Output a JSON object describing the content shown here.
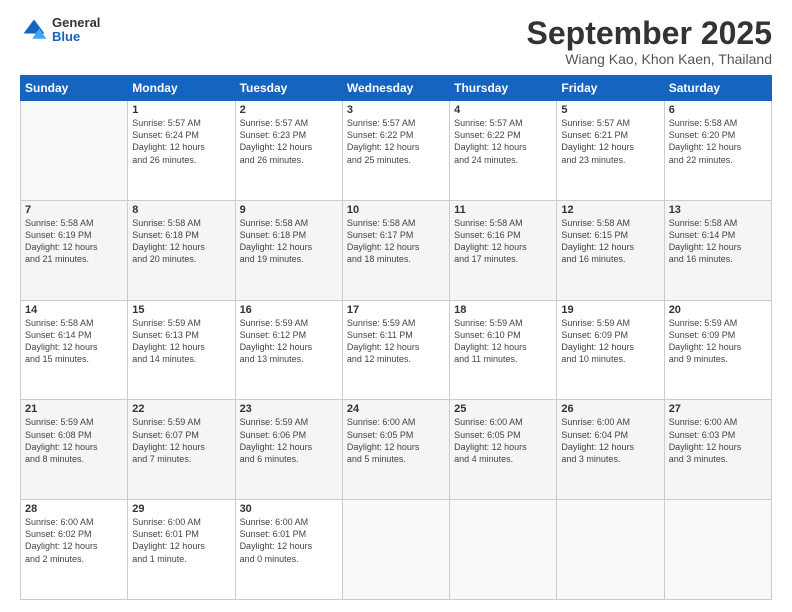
{
  "header": {
    "logo_general": "General",
    "logo_blue": "Blue",
    "month_title": "September 2025",
    "location": "Wiang Kao, Khon Kaen, Thailand"
  },
  "days_of_week": [
    "Sunday",
    "Monday",
    "Tuesday",
    "Wednesday",
    "Thursday",
    "Friday",
    "Saturday"
  ],
  "weeks": [
    [
      {
        "num": "",
        "info": ""
      },
      {
        "num": "1",
        "info": "Sunrise: 5:57 AM\nSunset: 6:24 PM\nDaylight: 12 hours\nand 26 minutes."
      },
      {
        "num": "2",
        "info": "Sunrise: 5:57 AM\nSunset: 6:23 PM\nDaylight: 12 hours\nand 26 minutes."
      },
      {
        "num": "3",
        "info": "Sunrise: 5:57 AM\nSunset: 6:22 PM\nDaylight: 12 hours\nand 25 minutes."
      },
      {
        "num": "4",
        "info": "Sunrise: 5:57 AM\nSunset: 6:22 PM\nDaylight: 12 hours\nand 24 minutes."
      },
      {
        "num": "5",
        "info": "Sunrise: 5:57 AM\nSunset: 6:21 PM\nDaylight: 12 hours\nand 23 minutes."
      },
      {
        "num": "6",
        "info": "Sunrise: 5:58 AM\nSunset: 6:20 PM\nDaylight: 12 hours\nand 22 minutes."
      }
    ],
    [
      {
        "num": "7",
        "info": "Sunrise: 5:58 AM\nSunset: 6:19 PM\nDaylight: 12 hours\nand 21 minutes."
      },
      {
        "num": "8",
        "info": "Sunrise: 5:58 AM\nSunset: 6:18 PM\nDaylight: 12 hours\nand 20 minutes."
      },
      {
        "num": "9",
        "info": "Sunrise: 5:58 AM\nSunset: 6:18 PM\nDaylight: 12 hours\nand 19 minutes."
      },
      {
        "num": "10",
        "info": "Sunrise: 5:58 AM\nSunset: 6:17 PM\nDaylight: 12 hours\nand 18 minutes."
      },
      {
        "num": "11",
        "info": "Sunrise: 5:58 AM\nSunset: 6:16 PM\nDaylight: 12 hours\nand 17 minutes."
      },
      {
        "num": "12",
        "info": "Sunrise: 5:58 AM\nSunset: 6:15 PM\nDaylight: 12 hours\nand 16 minutes."
      },
      {
        "num": "13",
        "info": "Sunrise: 5:58 AM\nSunset: 6:14 PM\nDaylight: 12 hours\nand 16 minutes."
      }
    ],
    [
      {
        "num": "14",
        "info": "Sunrise: 5:58 AM\nSunset: 6:14 PM\nDaylight: 12 hours\nand 15 minutes."
      },
      {
        "num": "15",
        "info": "Sunrise: 5:59 AM\nSunset: 6:13 PM\nDaylight: 12 hours\nand 14 minutes."
      },
      {
        "num": "16",
        "info": "Sunrise: 5:59 AM\nSunset: 6:12 PM\nDaylight: 12 hours\nand 13 minutes."
      },
      {
        "num": "17",
        "info": "Sunrise: 5:59 AM\nSunset: 6:11 PM\nDaylight: 12 hours\nand 12 minutes."
      },
      {
        "num": "18",
        "info": "Sunrise: 5:59 AM\nSunset: 6:10 PM\nDaylight: 12 hours\nand 11 minutes."
      },
      {
        "num": "19",
        "info": "Sunrise: 5:59 AM\nSunset: 6:09 PM\nDaylight: 12 hours\nand 10 minutes."
      },
      {
        "num": "20",
        "info": "Sunrise: 5:59 AM\nSunset: 6:09 PM\nDaylight: 12 hours\nand 9 minutes."
      }
    ],
    [
      {
        "num": "21",
        "info": "Sunrise: 5:59 AM\nSunset: 6:08 PM\nDaylight: 12 hours\nand 8 minutes."
      },
      {
        "num": "22",
        "info": "Sunrise: 5:59 AM\nSunset: 6:07 PM\nDaylight: 12 hours\nand 7 minutes."
      },
      {
        "num": "23",
        "info": "Sunrise: 5:59 AM\nSunset: 6:06 PM\nDaylight: 12 hours\nand 6 minutes."
      },
      {
        "num": "24",
        "info": "Sunrise: 6:00 AM\nSunset: 6:05 PM\nDaylight: 12 hours\nand 5 minutes."
      },
      {
        "num": "25",
        "info": "Sunrise: 6:00 AM\nSunset: 6:05 PM\nDaylight: 12 hours\nand 4 minutes."
      },
      {
        "num": "26",
        "info": "Sunrise: 6:00 AM\nSunset: 6:04 PM\nDaylight: 12 hours\nand 3 minutes."
      },
      {
        "num": "27",
        "info": "Sunrise: 6:00 AM\nSunset: 6:03 PM\nDaylight: 12 hours\nand 3 minutes."
      }
    ],
    [
      {
        "num": "28",
        "info": "Sunrise: 6:00 AM\nSunset: 6:02 PM\nDaylight: 12 hours\nand 2 minutes."
      },
      {
        "num": "29",
        "info": "Sunrise: 6:00 AM\nSunset: 6:01 PM\nDaylight: 12 hours\nand 1 minute."
      },
      {
        "num": "30",
        "info": "Sunrise: 6:00 AM\nSunset: 6:01 PM\nDaylight: 12 hours\nand 0 minutes."
      },
      {
        "num": "",
        "info": ""
      },
      {
        "num": "",
        "info": ""
      },
      {
        "num": "",
        "info": ""
      },
      {
        "num": "",
        "info": ""
      }
    ]
  ]
}
